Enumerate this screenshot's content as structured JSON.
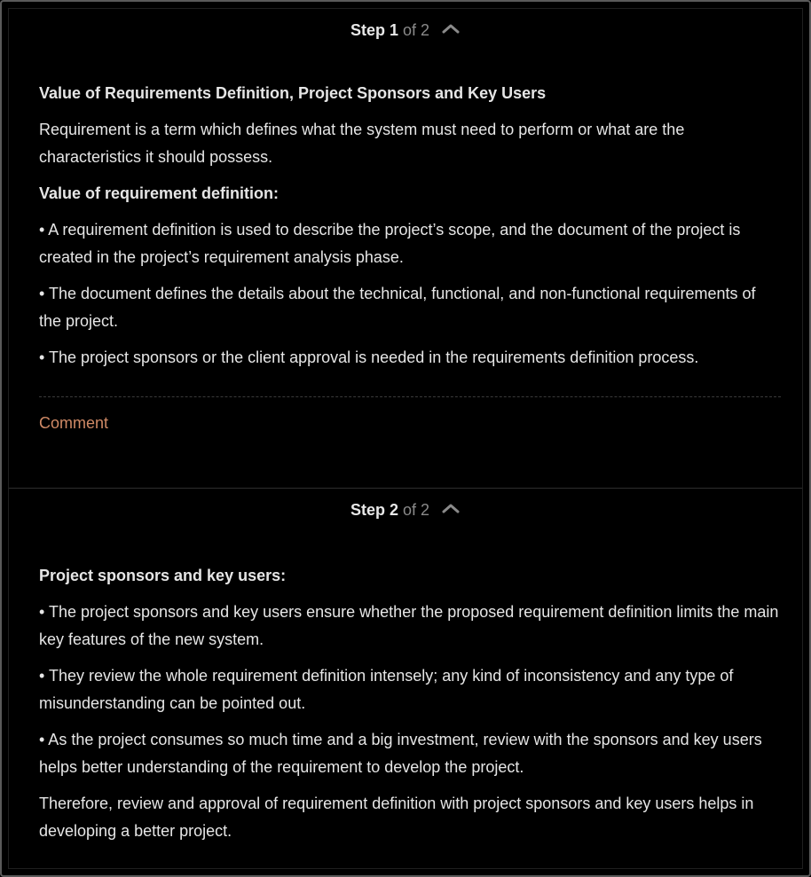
{
  "steps": [
    {
      "step_word": "Step",
      "number": "1",
      "of_text": "of 2",
      "icon": "chevron-up-icon",
      "title": "Value of Requirements Definition, Project Sponsors and Key Users",
      "intro": "Requirement is a term which defines what the system must need to perform or what are the characteristics it should possess.",
      "subheading": "Value of requirement definition:",
      "bullets": [
        "• A requirement definition is used to describe the project’s scope, and the document of the project is created in the project’s requirement analysis phase.",
        "• The document defines the details about the technical, functional, and non-functional requirements of the project.",
        "• The project sponsors or the client approval is needed in the requirements definition process."
      ],
      "comment_label": "Comment"
    },
    {
      "step_word": "Step",
      "number": "2",
      "of_text": "of 2",
      "icon": "chevron-up-icon",
      "subheading": "Project sponsors and key users:",
      "bullets": [
        "• The project sponsors and key users ensure whether the proposed requirement definition limits the main key features of the new system.",
        "• They review the whole requirement definition intensely; any kind of inconsistency and any type of misunderstanding can be pointed out.",
        "• As the project consumes so much time and a big investment, review with the sponsors and key users helps better understanding of the requirement to develop the project."
      ],
      "conclusion": "Therefore, review and approval of requirement definition with project sponsors and key users helps in developing a better project."
    }
  ],
  "colors": {
    "background": "#000000",
    "text": "#e6e6e6",
    "muted": "#8a8a8a",
    "comment_link": "#d08a66"
  }
}
